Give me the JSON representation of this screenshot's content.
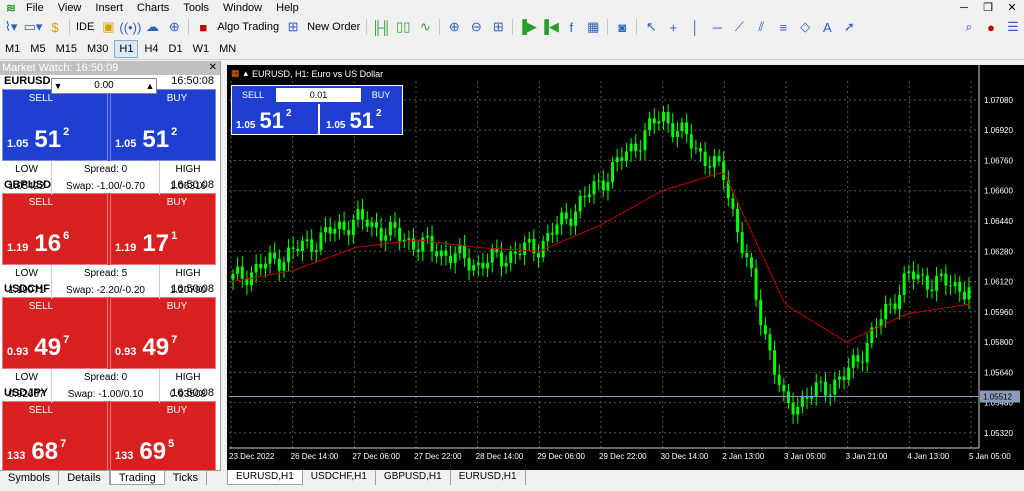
{
  "menu": [
    "File",
    "View",
    "Insert",
    "Charts",
    "Tools",
    "Window",
    "Help"
  ],
  "toolbar": {
    "ide": "IDE",
    "algo_trading": "Algo Trading",
    "new_order": "New Order"
  },
  "timeframes": [
    "M1",
    "M5",
    "M15",
    "M30",
    "H1",
    "H4",
    "D1",
    "W1",
    "MN"
  ],
  "active_timeframe": "H1",
  "market_watch": {
    "title": "Market Watch: 16:50:09",
    "symbols": [
      {
        "name": "EURUSD",
        "time": "16:50:08",
        "color": "blue",
        "volume": "0.00",
        "sell_small": "1.05",
        "sell_big": "51",
        "sell_sup": "2",
        "buy_small": "1.05",
        "buy_big": "51",
        "buy_sup": "2",
        "low_label": "LOW",
        "low": "1.05422",
        "spread": "Spread: 0",
        "swap": "Swap: -1.00/-0.70",
        "high_label": "HIGH",
        "high": "1.06316"
      },
      {
        "name": "GBPUSD",
        "time": "16:50:08",
        "color": "red",
        "volume": "0.00",
        "sell_small": "1.19",
        "sell_big": "16",
        "sell_sup": "6",
        "buy_small": "1.19",
        "buy_big": "17",
        "buy_sup": "1",
        "low_label": "LOW",
        "low": "1.19071",
        "spread": "Spread: 5",
        "swap": "Swap: -2.20/-0.20",
        "high_label": "HIGH",
        "high": "1.20790"
      },
      {
        "name": "USDCHF",
        "time": "16:50:08",
        "color": "red",
        "volume": "0.00",
        "sell_small": "0.93",
        "sell_big": "49",
        "sell_sup": "7",
        "buy_small": "0.93",
        "buy_big": "49",
        "buy_sup": "7",
        "low_label": "LOW",
        "low": "0.92607",
        "spread": "Spread: 0",
        "swap": "Swap: -1.00/0.10",
        "high_label": "HIGH",
        "high": "0.93508"
      },
      {
        "name": "USDJPY",
        "time": "16:50:08",
        "color": "red",
        "volume": "0.00",
        "sell_small": "133",
        "sell_big": "68",
        "sell_sup": "7",
        "buy_small": "133",
        "buy_big": "69",
        "buy_sup": "5"
      }
    ],
    "sell_label": "SELL",
    "buy_label": "BUY",
    "tabs": [
      "Symbols",
      "Details",
      "Trading",
      "Ticks"
    ],
    "active_tab": "Trading"
  },
  "chart": {
    "title": "EURUSD, H1:  Euro vs US Dollar",
    "trade_panel": {
      "sell": "SELL",
      "buy": "BUY",
      "volume": "0.01",
      "sell_small": "1.05",
      "sell_big": "51",
      "sell_sup": "2",
      "buy_small": "1.05",
      "buy_big": "51",
      "buy_sup": "2"
    },
    "y_labels": [
      "1.07080",
      "1.06920",
      "1.06760",
      "1.06600",
      "1.06440",
      "1.06280",
      "1.06120",
      "1.05960",
      "1.05800",
      "1.05640",
      "1.05480",
      "1.05320"
    ],
    "x_labels": [
      "23 Dec 2022",
      "26 Dec 14:00",
      "27 Dec 06:00",
      "27 Dec 22:00",
      "28 Dec 14:00",
      "29 Dec 06:00",
      "29 Dec 22:00",
      "30 Dec 14:00",
      "2 Jan 13:00",
      "3 Jan 05:00",
      "3 Jan 21:00",
      "4 Jan 13:00",
      "5 Jan 05:00"
    ],
    "current_price": "1.05512",
    "bull_color": "#00ff00",
    "bg_color": "#000000",
    "ma_color": "#c00000"
  },
  "chart_tabs": [
    "EURUSD,H1",
    "USDCHF,H1",
    "GBPUSD,H1",
    "EURUSD,H1"
  ],
  "active_chart_tab": "EURUSD,H1",
  "chart_data": {
    "type": "line",
    "title": "EURUSD, H1:  Euro vs US Dollar",
    "x": [
      "23 Dec 2022",
      "26 Dec 14:00",
      "27 Dec 06:00",
      "27 Dec 22:00",
      "28 Dec 14:00",
      "29 Dec 06:00",
      "29 Dec 22:00",
      "30 Dec 14:00",
      "2 Jan 13:00",
      "3 Jan 05:00",
      "3 Jan 21:00",
      "4 Jan 13:00",
      "5 Jan 05:00"
    ],
    "series": [
      {
        "values": [
          1.0613,
          1.0628,
          1.0645,
          1.0632,
          1.0621,
          1.0631,
          1.0665,
          1.07,
          1.0668,
          1.0545,
          1.0562,
          1.0615,
          1.0608
        ]
      },
      {
        "values": [
          1.0612,
          1.0618,
          1.063,
          1.0634,
          1.063,
          1.0628,
          1.0642,
          1.066,
          1.067,
          1.06,
          1.058,
          1.0595,
          1.06
        ]
      }
    ],
    "ylim": [
      1.0524,
      1.0718
    ],
    "grid": true
  }
}
